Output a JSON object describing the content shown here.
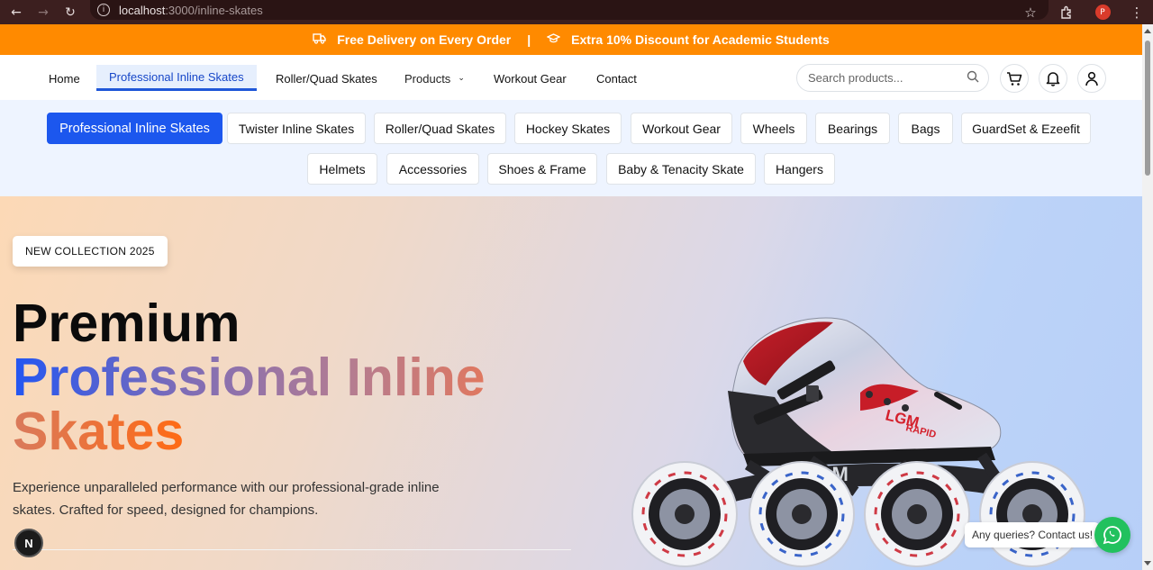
{
  "browser": {
    "url_host": "localhost",
    "url_path": ":3000/inline-skates",
    "profile_initial": "P",
    "icons": [
      "back-icon",
      "forward-icon",
      "reload-icon",
      "info-icon",
      "star-icon",
      "extensions-icon"
    ]
  },
  "promo": {
    "delivery": "Free Delivery on Every Order",
    "separator": "|",
    "discount": "Extra 10% Discount for Academic Students",
    "color": "#ff8a00"
  },
  "nav": {
    "home": "Home",
    "professional": "Professional Inline Skates",
    "roller": "Roller/Quad Skates",
    "products": "Products",
    "workout": "Workout Gear",
    "contact": "Contact",
    "search_placeholder": "Search products...",
    "active_color": "#1f57d8"
  },
  "categories": {
    "row1": [
      "Professional Inline Skates",
      "Twister Inline Skates",
      "Roller/Quad Skates",
      "Hockey Skates",
      "Workout Gear",
      "Wheels",
      "Bearings",
      "Bags",
      "GuardSet & Ezeefit"
    ],
    "row2": [
      "Helmets",
      "Accessories",
      "Shoes & Frame",
      "Baby & Tenacity Skate",
      "Hangers"
    ],
    "active": "Professional Inline Skates",
    "active_color": "#1c57ee"
  },
  "hero": {
    "badge": "NEW COLLECTION 2025",
    "title_line1": "Premium",
    "title_line2": "Professional Inline",
    "title_line3": "Skates",
    "description": "Experience unparalleled performance with our professional-grade inline skates. Crafted for speed, designed for champions.",
    "product_brand": "LGM",
    "product_model": "RAPID"
  },
  "floating": {
    "next_badge": "N",
    "contact_text": "Any queries? Contact us!",
    "whatsapp_color": "#22c15e"
  }
}
